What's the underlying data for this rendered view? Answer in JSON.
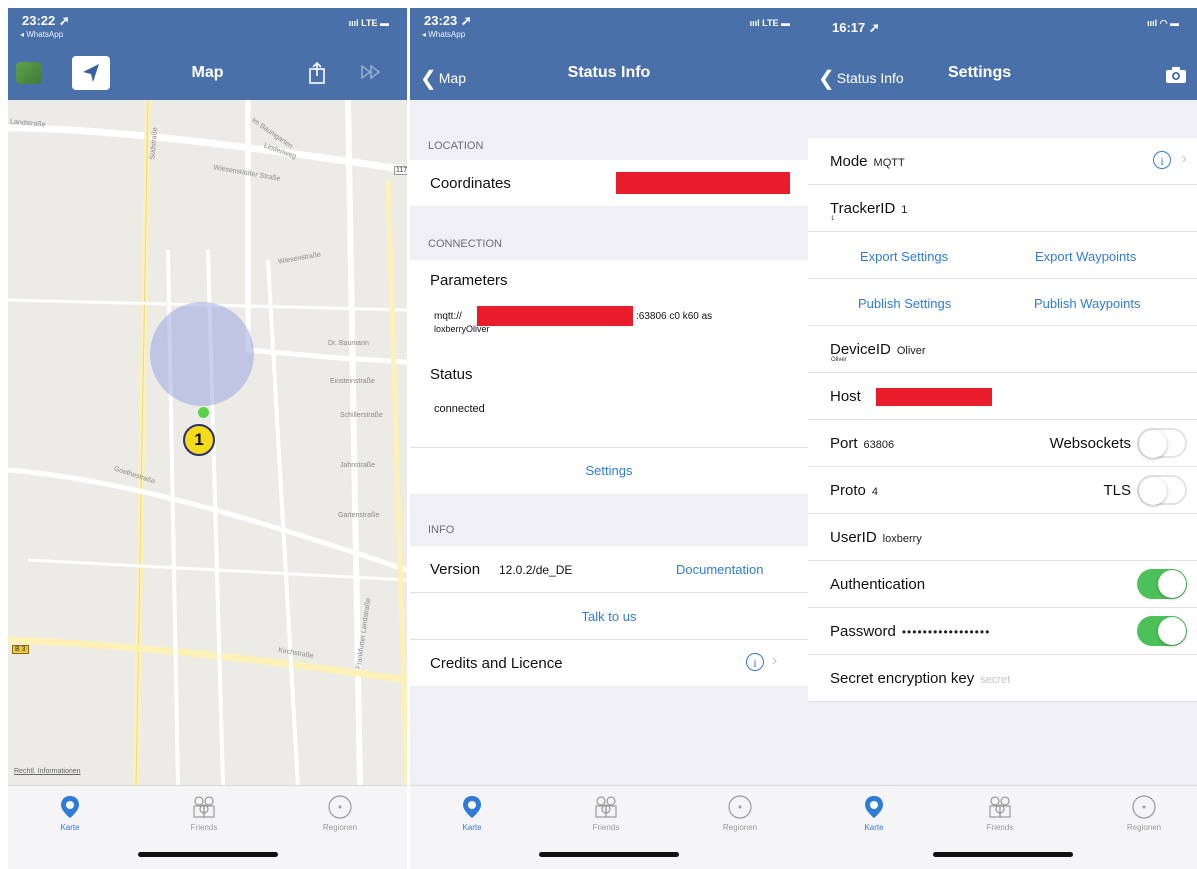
{
  "panels": [
    {
      "status": {
        "time": "23:22 ➚",
        "back_app": "◂ WhatsApp",
        "signal": "ıııl LTE ▬"
      },
      "nav": {
        "title": "Map",
        "share_icon": "share-icon",
        "forward_icon": "fast-forward-icon"
      },
      "map": {
        "streets": [
          "Landstraße",
          "Südstraße",
          "Im Baumgarten",
          "Lindenweg",
          "Wiesenstädter Straße",
          "117",
          "Wiesenstraße",
          "Dr. Baumann",
          "Einsteinstraße",
          "Schillerstraße",
          "Jahnstraße",
          "Gartenstraße",
          "Goethestraße",
          "Frankfurter Landstraße",
          "Kirchstraße",
          "B 3"
        ],
        "marker_label": "1",
        "legal": "Rechtl. Informationen"
      },
      "tabs": [
        "Karte",
        "Friends",
        "Regionen"
      ]
    },
    {
      "status": {
        "time": "23:23 ➚",
        "back_app": "◂ WhatsApp",
        "signal": "ıııl LTE ▬"
      },
      "nav": {
        "back": "Map",
        "title": "Status Info"
      },
      "location": {
        "header": "LOCATION",
        "coordinates_label": "Coordinates"
      },
      "connection": {
        "header": "CONNECTION",
        "parameters_label": "Parameters",
        "param_prefix": "mqtt://",
        "param_suffix": ":63806 c0 k60 as",
        "param_line2": "loxberryOliver",
        "status_label": "Status",
        "status_value": "connected",
        "settings_link": "Settings"
      },
      "info": {
        "header": "INFO",
        "version_label": "Version",
        "version_value": "12.0.2/de_DE",
        "documentation_link": "Documentation",
        "talk_link": "Talk to us",
        "credits_label": "Credits and Licence"
      },
      "tabs": [
        "Karte",
        "Friends",
        "Regionen"
      ]
    },
    {
      "status": {
        "time": "16:17 ➚",
        "signal": "ıııl ◠ ▬"
      },
      "nav": {
        "back": "Status Info",
        "title": "Settings",
        "camera_icon": "camera-icon"
      },
      "settings": {
        "mode_label": "Mode",
        "mode_value": "MQTT",
        "tracker_label": "TrackerID",
        "tracker_value": "1",
        "tracker_sub": "1",
        "export_settings": "Export Settings",
        "export_waypoints": "Export Waypoints",
        "publish_settings": "Publish Settings",
        "publish_waypoints": "Publish Waypoints",
        "device_label": "DeviceID",
        "device_value": "Oliver",
        "device_sub": "Oliver",
        "host_label": "Host",
        "port_label": "Port",
        "port_value": "63806",
        "websockets_label": "Websockets",
        "websockets_on": false,
        "proto_label": "Proto",
        "proto_value": "4",
        "tls_label": "TLS",
        "tls_on": false,
        "user_label": "UserID",
        "user_value": "loxberry",
        "auth_label": "Authentication",
        "auth_on": true,
        "password_label": "Password",
        "password_value": "•••••••••••••••••",
        "password_on": true,
        "secret_label": "Secret encryption key",
        "secret_placeholder": "secret"
      },
      "tabs": [
        "Karte",
        "Friends",
        "Regionen"
      ]
    }
  ],
  "colors": {
    "nav": "#4a70a9",
    "accent": "#2f7cd8",
    "toggle_on": "#4cc159",
    "redaction": "#e81c2a"
  }
}
